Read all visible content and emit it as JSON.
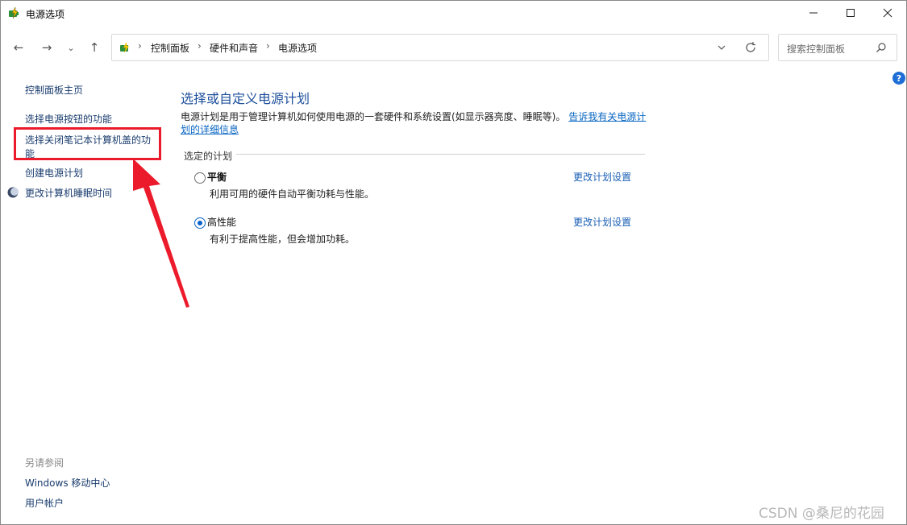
{
  "window": {
    "title": "电源选项",
    "controls": {
      "minimize": "minimize",
      "maximize": "maximize",
      "close": "close"
    }
  },
  "nav": {
    "back_icon": "←",
    "forward_icon": "→",
    "recent_icon": "⌄",
    "up_icon": "↑",
    "breadcrumb": [
      "控制面板",
      "硬件和声音",
      "电源选项"
    ],
    "search_placeholder": "搜索控制面板"
  },
  "help": {
    "label": "?"
  },
  "sidebar": {
    "home": "控制面板主页",
    "items": [
      "选择电源按钮的功能",
      "选择关闭笔记本计算机盖的功能",
      "创建电源计划",
      "更改计算机睡眠时间"
    ],
    "wrapped_item_line1": "选择关闭笔记本计算机盖的功",
    "wrapped_item_line2": "能",
    "see_also_title": "另请参阅",
    "see_also": [
      "Windows 移动中心",
      "用户帐户"
    ]
  },
  "main": {
    "title": "选择或自定义电源计划",
    "description": "电源计划是用于管理计算机如何使用电源的一套硬件和系统设置(如显示器亮度、睡眠等)。",
    "description_link_line1": "告诉我有关电源计",
    "description_link_line2": "划的详细信息",
    "selected_plans_label": "选定的计划",
    "plans": [
      {
        "name": "平衡",
        "description": "利用可用的硬件自动平衡功耗与性能。",
        "link": "更改计划设置",
        "selected": false
      },
      {
        "name": "高性能",
        "description": "有利于提高性能，但会增加功耗。",
        "link": "更改计划设置",
        "selected": true
      }
    ]
  },
  "annotation": {
    "highlight_color": "#ec1b2b"
  },
  "watermark": "CSDN @桑尼的花园"
}
